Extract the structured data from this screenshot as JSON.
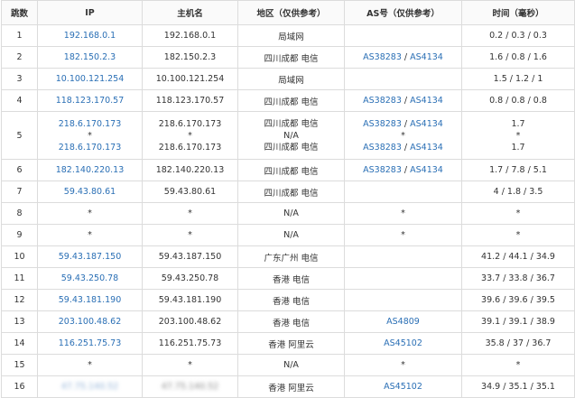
{
  "headers": {
    "hop": "跳数",
    "ip": "IP",
    "host": "主机名",
    "region": "地区（仅供参考）",
    "as": "AS号（仅供参考）",
    "time": "时间（毫秒）"
  },
  "rows": [
    {
      "hop": "1",
      "ip": "192.168.0.1",
      "host": "192.168.0.1",
      "region": "局域网",
      "as1": "",
      "as2": "",
      "time": "0.2 / 0.3 / 0.3"
    },
    {
      "hop": "2",
      "ip": "182.150.2.3",
      "host": "182.150.2.3",
      "region": "四川成都 电信",
      "as1": "AS38283",
      "as2": "AS4134",
      "time": "1.6 / 0.8 / 1.6"
    },
    {
      "hop": "3",
      "ip": "10.100.121.254",
      "host": "10.100.121.254",
      "region": "局域网",
      "as1": "",
      "as2": "",
      "time": "1.5 / 1.2 / 1"
    },
    {
      "hop": "4",
      "ip": "118.123.170.57",
      "host": "118.123.170.57",
      "region": "四川成都 电信",
      "as1": "AS38283",
      "as2": "AS4134",
      "time": "0.8 / 0.8 / 0.8"
    },
    {
      "hop": "5",
      "ip_a": "218.6.170.173",
      "ip_b": "*",
      "ip_c": "218.6.170.173",
      "host_a": "218.6.170.173",
      "host_b": "*",
      "host_c": "218.6.170.173",
      "region_a": "四川成都 电信",
      "region_b": "N/A",
      "region_c": "四川成都 电信",
      "as_a1": "AS38283",
      "as_a2": "AS4134",
      "as_b": "*",
      "as_c1": "AS38283",
      "as_c2": "AS4134",
      "time_a": "1.7",
      "time_b": "*",
      "time_c": "1.7"
    },
    {
      "hop": "6",
      "ip": "182.140.220.13",
      "host": "182.140.220.13",
      "region": "四川成都 电信",
      "as1": "AS38283",
      "as2": "AS4134",
      "time": "1.7 / 7.8 / 5.1"
    },
    {
      "hop": "7",
      "ip": "59.43.80.61",
      "host": "59.43.80.61",
      "region": "四川成都 电信",
      "as1": "",
      "as2": "",
      "time": "4 / 1.8 / 3.5"
    },
    {
      "hop": "8",
      "ip": "*",
      "host": "*",
      "region": "N/A",
      "as1": "*",
      "as2": "",
      "time": "*"
    },
    {
      "hop": "9",
      "ip": "*",
      "host": "*",
      "region": "N/A",
      "as1": "*",
      "as2": "",
      "time": "*"
    },
    {
      "hop": "10",
      "ip": "59.43.187.150",
      "host": "59.43.187.150",
      "region": "广东广州 电信",
      "as1": "",
      "as2": "",
      "time": "41.2 / 44.1 / 34.9"
    },
    {
      "hop": "11",
      "ip": "59.43.250.78",
      "host": "59.43.250.78",
      "region": "香港 电信",
      "as1": "",
      "as2": "",
      "time": "33.7 / 33.8 / 36.7"
    },
    {
      "hop": "12",
      "ip": "59.43.181.190",
      "host": "59.43.181.190",
      "region": "香港 电信",
      "as1": "",
      "as2": "",
      "time": "39.6 / 39.6 / 39.5"
    },
    {
      "hop": "13",
      "ip": "203.100.48.62",
      "host": "203.100.48.62",
      "region": "香港 电信",
      "as1": "AS4809",
      "as2": "",
      "time": "39.1 / 39.1 / 38.9"
    },
    {
      "hop": "14",
      "ip": "116.251.75.73",
      "host": "116.251.75.73",
      "region": "香港 阿里云",
      "as1": "AS45102",
      "as2": "",
      "time": "35.8 / 37 / 36.7"
    },
    {
      "hop": "15",
      "ip": "*",
      "host": "*",
      "region": "N/A",
      "as1": "*",
      "as2": "",
      "time": "*"
    },
    {
      "hop": "16",
      "ip_blurred": "47.75.140.52",
      "host_blurred": "47.75.140.52",
      "region": "香港 阿里云",
      "as1": "AS45102",
      "as2": "",
      "time": "34.9 / 35.1 / 35.1"
    }
  ]
}
